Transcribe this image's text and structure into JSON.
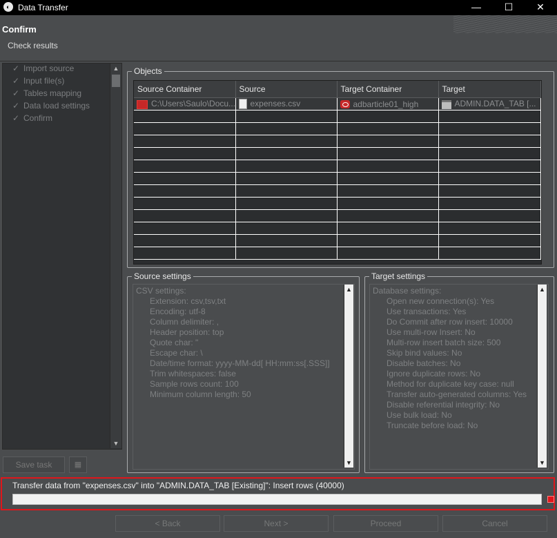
{
  "window": {
    "title": "Data Transfer",
    "minimize_glyph": "—",
    "maximize_glyph": "☐",
    "close_glyph": "✕"
  },
  "header": {
    "title": "Confirm",
    "subtitle": "Check results"
  },
  "steps": [
    {
      "label": "Import source"
    },
    {
      "label": "Input file(s)"
    },
    {
      "label": "Tables mapping"
    },
    {
      "label": "Data load settings"
    },
    {
      "label": "Confirm"
    }
  ],
  "left_buttons": {
    "save_task": "Save task"
  },
  "objects": {
    "legend": "Objects",
    "columns": [
      "Source Container",
      "Source",
      "Target Container",
      "Target"
    ],
    "rows": [
      {
        "source_container": "C:\\Users\\Saulo\\Docu...",
        "source": "expenses.csv",
        "target_container": "adbarticle01_high",
        "target": "ADMIN.DATA_TAB [..."
      }
    ]
  },
  "source_settings": {
    "legend": "Source settings",
    "heading": "CSV settings:",
    "lines": [
      "Extension: csv,tsv,txt",
      "Encoding: utf-8",
      "Column delimiter: ,",
      "Header position: top",
      "Quote char: \"",
      "Escape char: \\",
      "Date/time format: yyyy-MM-dd[ HH:mm:ss[.SSS]]",
      "Trim whitespaces: false",
      "Sample rows count: 100",
      "Minimum column length: 50"
    ]
  },
  "target_settings": {
    "legend": "Target settings",
    "heading": "Database settings:",
    "lines": [
      "Open new connection(s): Yes",
      "Use transactions: Yes",
      "Do Commit after row insert: 10000",
      "Use multi-row Insert: No",
      "Multi-row insert batch size: 500",
      "Skip bind values: No",
      "Disable batches: No",
      "Ignore duplicate rows: No",
      "Method for duplicate key case: null",
      "Transfer auto-generated columns: Yes",
      "Disable referential integrity: No",
      "Use bulk load: No",
      "Truncate before load: No"
    ]
  },
  "status": {
    "text": "Transfer data from \"expenses.csv\" into \"ADMIN.DATA_TAB [Existing]\": Insert rows (40000)",
    "progress": 0
  },
  "footer": {
    "back": "< Back",
    "next": "Next >",
    "proceed": "Proceed",
    "cancel": "Cancel"
  },
  "colors": {
    "highlight_border": "#e0161b",
    "background": "#4a4c4e"
  }
}
